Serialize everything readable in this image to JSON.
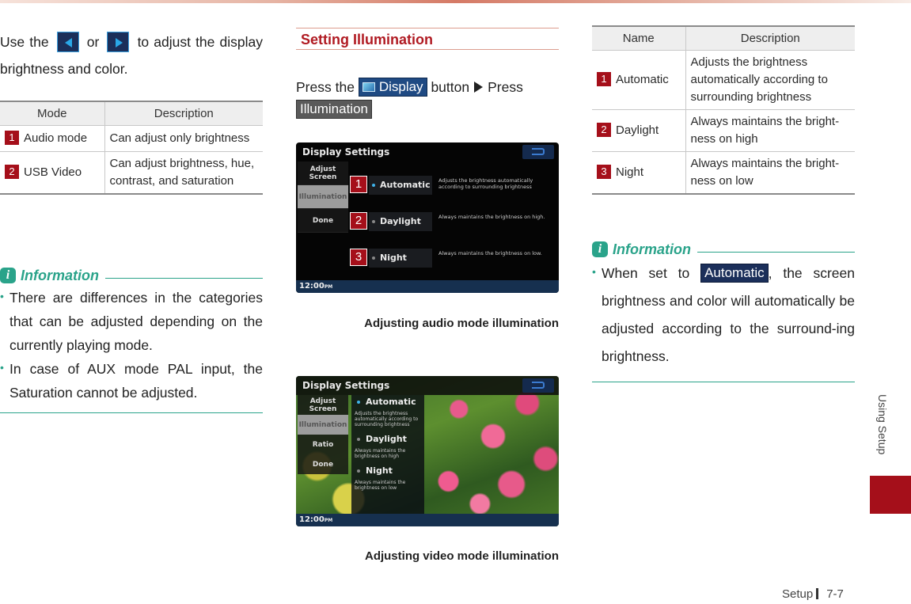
{
  "page": {
    "section_tab": "Using Setup",
    "footer_section": "Setup",
    "footer_page": "7-7",
    "accent_color": "#a50f1a",
    "info_color": "#2aa38a"
  },
  "left": {
    "intro": {
      "part1": "Use the",
      "left_button": "left-arrow",
      "or": "or",
      "right_button": "right-arrow",
      "part2": "to adjust the display brightness and color."
    },
    "mode_table": {
      "headers": [
        "Mode",
        "Description"
      ],
      "rows": [
        {
          "num": "1",
          "mode": "Audio mode",
          "description": "Can adjust only brightness"
        },
        {
          "num": "2",
          "mode": "USB Video",
          "description": "Can adjust brightness, hue, contrast, and saturation"
        }
      ]
    },
    "info": {
      "title": "Information",
      "icon": "i",
      "bullets": [
        "There are differences in the categories that can be adjusted depending on the currently playing mode.",
        "In case of AUX mode PAL input, the Saturation cannot be adjusted."
      ]
    }
  },
  "middle": {
    "section_title": "Setting Illumination",
    "instruction": {
      "press_the": "Press the",
      "display_chip": "Display",
      "button": "button",
      "press": "Press",
      "illumination_chip": "Illumination"
    },
    "audio_screen": {
      "title": "Display Settings",
      "menu": [
        "Adjust Screen",
        "Illumination",
        "Done"
      ],
      "selected_menu": "Illumination",
      "options": [
        {
          "num": "1",
          "label": "Automatic",
          "description": "Adjusts the brightness automatically according to surrounding brightness",
          "selected": true
        },
        {
          "num": "2",
          "label": "Daylight",
          "description": "Always maintains the brightness on high.",
          "selected": false
        },
        {
          "num": "3",
          "label": "Night",
          "description": "Always maintains the brightness on low.",
          "selected": false
        }
      ],
      "clock": "12:00",
      "clock_suffix": "PM"
    },
    "audio_caption": "Adjusting audio mode illumination",
    "video_screen": {
      "title": "Display Settings",
      "menu": [
        "Adjust Screen",
        "Illumination",
        "Ratio",
        "Done"
      ],
      "selected_menu": "Illumination",
      "options": [
        {
          "label": "Automatic",
          "description": "Adjusts the brightness automatically according to surrounding brightness",
          "selected": true
        },
        {
          "label": "Daylight",
          "description": "Always maintains the brightness on high",
          "selected": false
        },
        {
          "label": "Night",
          "description": "Always maintains the brightness on low",
          "selected": false
        }
      ],
      "clock": "12:00",
      "clock_suffix": "PM"
    },
    "video_caption": "Adjusting video mode illumination"
  },
  "right": {
    "name_table": {
      "headers": [
        "Name",
        "Description"
      ],
      "rows": [
        {
          "num": "1",
          "name": "Automatic",
          "description": "Adjusts the brightness automatically according to surrounding brightness"
        },
        {
          "num": "2",
          "name": "Daylight",
          "description": "Always maintains the bright-ness on high"
        },
        {
          "num": "3",
          "name": "Night",
          "description": "Always maintains the bright-ness on low"
        }
      ]
    },
    "info": {
      "title": "Information",
      "icon": "i",
      "text_before": "When set to",
      "chip": "Automatic",
      "text_after": ", the screen brightness and color will automatically be adjusted according to the surround-ing brightness."
    }
  }
}
